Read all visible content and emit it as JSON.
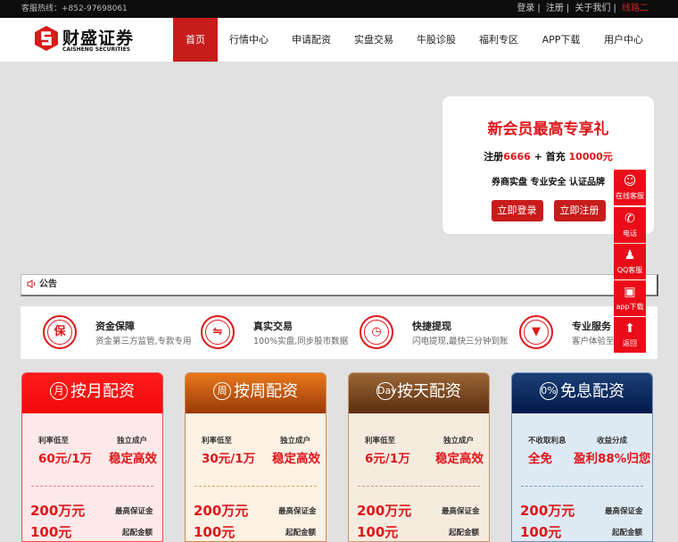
{
  "topbar": {
    "hotline": "客服热线：+852-97698061",
    "links": [
      "登录",
      "注册",
      "关于我们",
      "线路二"
    ]
  },
  "logo": {
    "name": "财盛证券",
    "sub": "CAISHENG SECURITIES"
  },
  "nav": [
    "首页",
    "行情中心",
    "申请配资",
    "实盘交易",
    "牛股诊股",
    "福利专区",
    "APP下载",
    "用户中心"
  ],
  "promo": {
    "title": "新会员最高专享礼",
    "line2_a": "注册",
    "line2_b": "6666",
    "line2_c": " + 首充 ",
    "line2_d": "10000元",
    "line3": "券商实盘 专业安全 认证品牌",
    "login": "立即登录",
    "register": "立即注册"
  },
  "notice": {
    "label": "公告"
  },
  "features": [
    {
      "title": "资金保障",
      "desc": "资金第三方监管,专款专用",
      "icon": "保"
    },
    {
      "title": "真实交易",
      "desc": "100%实盘,同步股市数据",
      "icon": "⇋"
    },
    {
      "title": "快捷提现",
      "desc": "闪电提现,最快三分钟到账",
      "icon": "◷"
    },
    {
      "title": "专业服务",
      "desc": "客户体验至上",
      "icon": "▼"
    }
  ],
  "cards": [
    {
      "title": "按月配资",
      "badge": "月",
      "l1": "利率低至",
      "v1": "60元/1万",
      "l2": "独立成户",
      "v2": "稳定高效",
      "amount": "200万元",
      "amount_label": "最高保证金",
      "min": "100元",
      "min_label": "起配金额"
    },
    {
      "title": "按周配资",
      "badge": "周",
      "l1": "利率低至",
      "v1": "30元/1万",
      "l2": "独立成户",
      "v2": "稳定高效",
      "amount": "200万元",
      "amount_label": "最高保证金",
      "min": "100元",
      "min_label": "起配金额"
    },
    {
      "title": "按天配资",
      "badge": "Day",
      "l1": "利率低至",
      "v1": "6元/1万",
      "l2": "独立成户",
      "v2": "稳定高效",
      "amount": "200万元",
      "amount_label": "最高保证金",
      "min": "100元",
      "min_label": "起配金额"
    },
    {
      "title": "免息配资",
      "badge": "0%",
      "l1": "不收取利息",
      "v1": "全免",
      "l2": "收益分成",
      "v2": "盈利88%归您",
      "amount": "200万元",
      "amount_label": "最高保证金",
      "min": "100元",
      "min_label": "起配金额"
    }
  ],
  "side": [
    "在线客服",
    "电话",
    "QQ客服",
    "app下载",
    "返回"
  ]
}
